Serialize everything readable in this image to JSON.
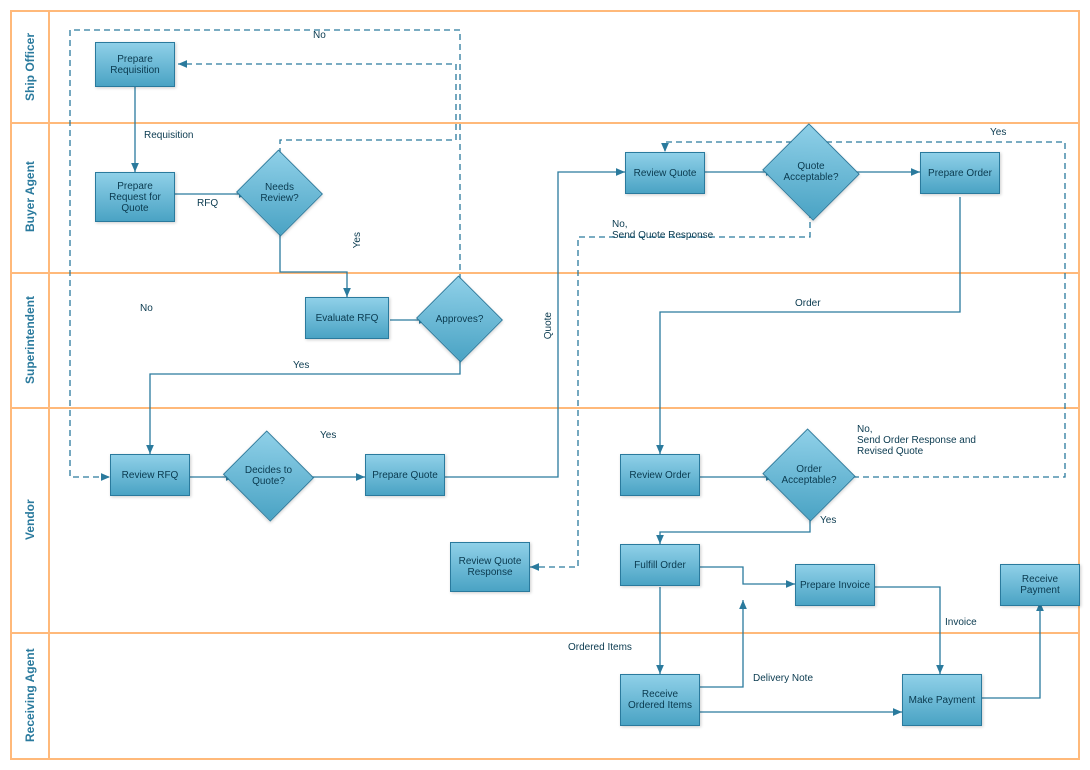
{
  "lanes": {
    "ship_officer": "Ship Officer",
    "buyer_agent": "Buyer Agent",
    "superintendent": "Superintendent",
    "vendor": "Vendor",
    "receiving_agent": "Receiving Agent"
  },
  "nodes": {
    "prepare_requisition": "Prepare Requisition",
    "prepare_rfq": "Prepare Request for Quote",
    "needs_review": "Needs Review?",
    "review_quote": "Review Quote",
    "quote_acceptable": "Quote Acceptable?",
    "prepare_order": "Prepare Order",
    "evaluate_rfq": "Evaluate RFQ",
    "approves": "Approves?",
    "review_rfq": "Review RFQ",
    "decides_to_quote": "Decides to Quote?",
    "prepare_quote": "Prepare Quote",
    "review_order": "Review Order",
    "order_acceptable": "Order Acceptable?",
    "fulfill_order": "Fulfill Order",
    "review_quote_response": "Review Quote Response",
    "prepare_invoice": "Prepare Invoice",
    "receive_payment": "Receive Payment",
    "receive_ordered_items": "Receive Ordered Items",
    "make_payment": "Make Payment"
  },
  "edges": {
    "no1": "No",
    "requisition": "Requisition",
    "rfq": "RFQ",
    "yes_needs_review": "Yes",
    "no_approves": "No",
    "yes_approves": "Yes",
    "yes_decides": "Yes",
    "quote": "Quote",
    "yes_quote_acceptable": "Yes",
    "no_send_quote_response": "No,\nSend Quote Response",
    "order": "Order",
    "no_send_order_response": "No,\nSend Order Response and\nRevised Quote",
    "yes_order_acceptable": "Yes",
    "ordered_items": "Ordered Items",
    "delivery_note": "Delivery Note",
    "invoice": "Invoice"
  }
}
